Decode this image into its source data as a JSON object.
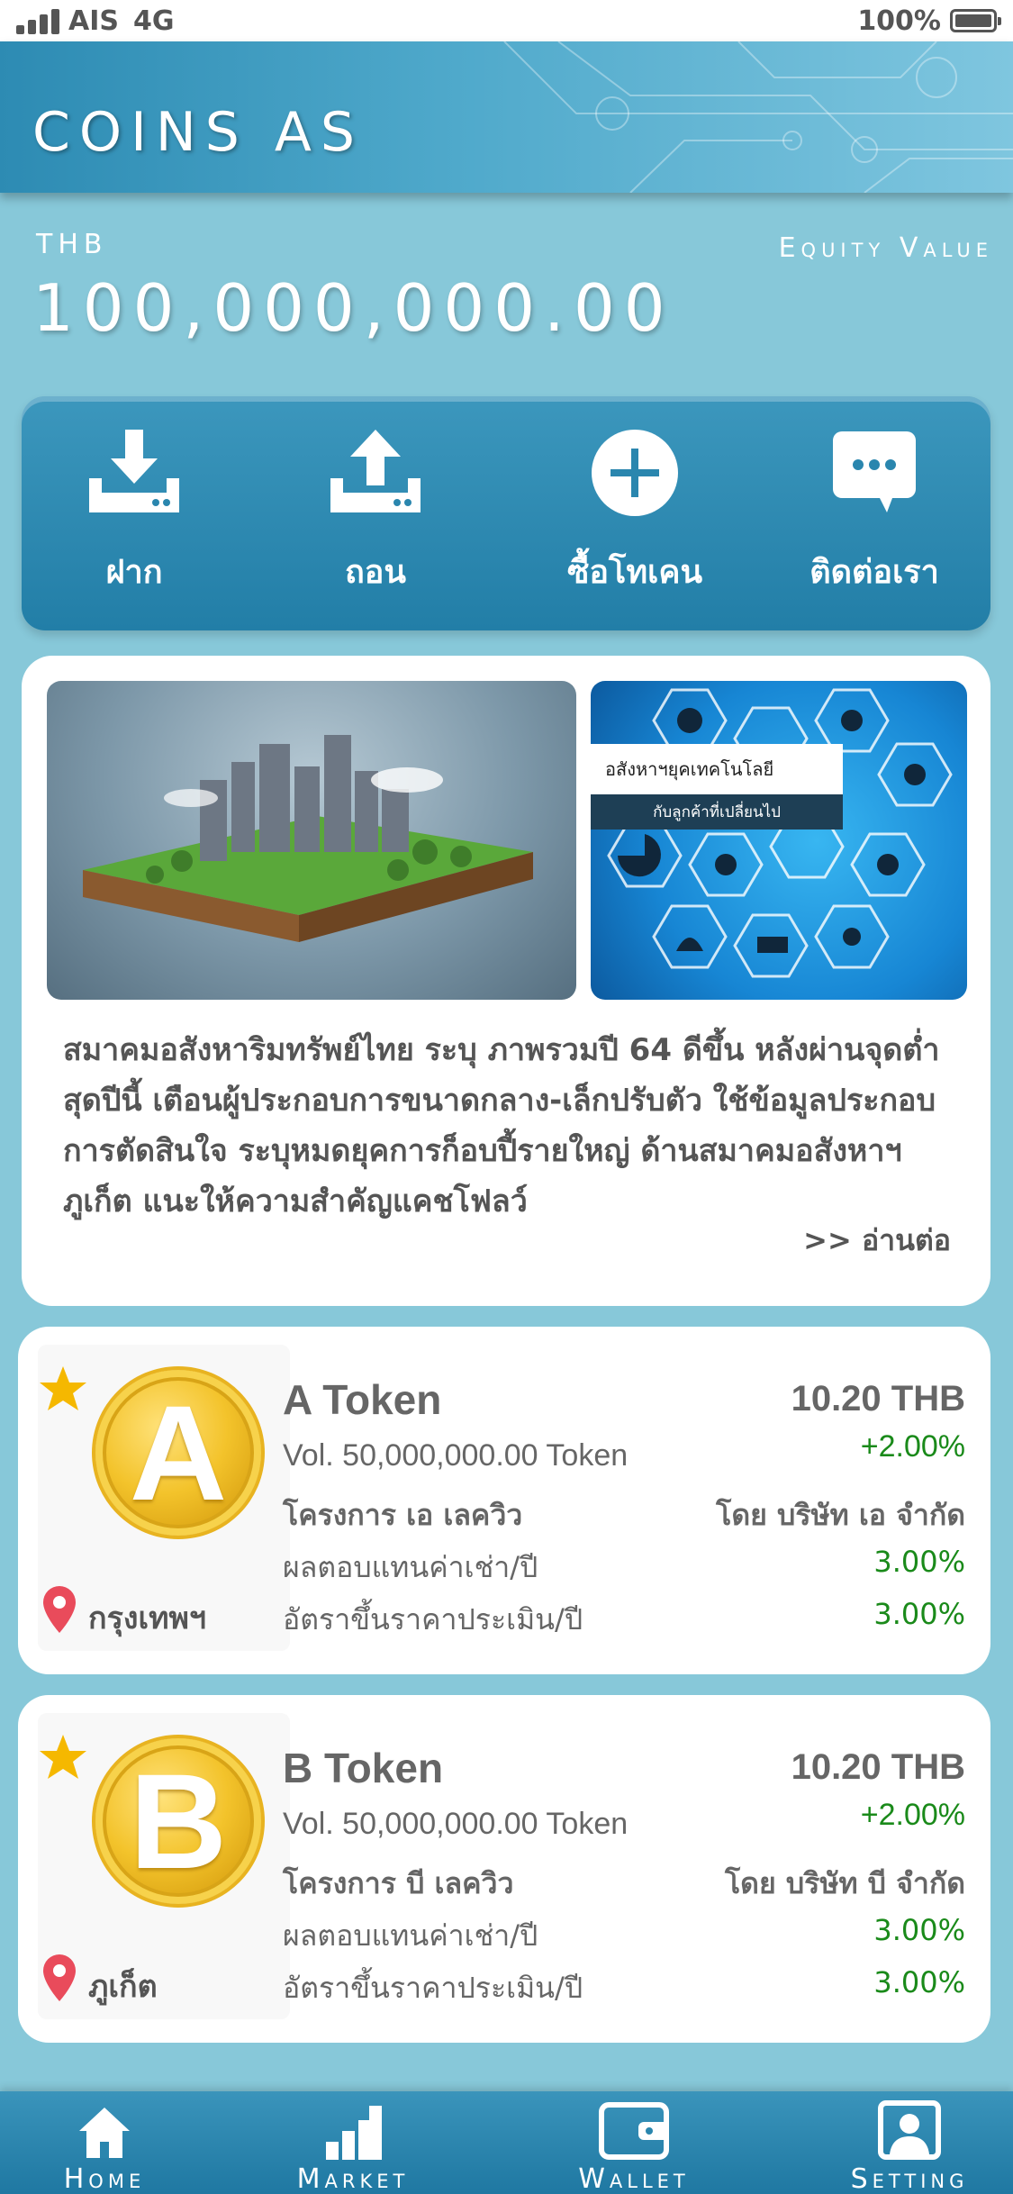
{
  "status_bar": {
    "carrier": "AIS",
    "network": "4G",
    "battery": "100%"
  },
  "header": {
    "title": "COINS AS"
  },
  "equity": {
    "currency": "THB",
    "label": "Equity Value",
    "value": "100,000,000.00"
  },
  "actions": [
    {
      "label": "ฝาก",
      "icon": "deposit-icon"
    },
    {
      "label": "ถอน",
      "icon": "withdraw-icon"
    },
    {
      "label": "ซื้อโทเคน",
      "icon": "plus-circle-icon"
    },
    {
      "label": "ติดต่อเรา",
      "icon": "chat-bubble-icon"
    }
  ],
  "news": {
    "image2_caption_main": "อสังหาฯยุคเทคโนโลยี",
    "image2_caption_sub": "กับลูกค้าที่เปลี่ยนไป",
    "text": "สมาคมอสังหาริมทรัพย์ไทย ระบุ ภาพรวมปี 64 ดีขึ้น หลังผ่านจุดต่ำสุดปีนี้ เตือนผู้ประกอบการขนาดกลาง-เล็กปรับตัว ใช้ข้อมูลประกอบการตัดสินใจ ระบุหมดยุคการก็อบปี้รายใหญ่ ด้านสมาคมอสังหาฯ ภูเก็ต แนะให้ความสำคัญแคชโฟลว์",
    "read_more": ">> อ่านต่อ"
  },
  "tokens": [
    {
      "coin_letter": "A",
      "name": "A Token",
      "price": "10.20 THB",
      "change": "+2.00%",
      "volume": "Vol. 50,000,000.00 Token",
      "project": "โครงการ เอ เลควิว",
      "company": "โดย บริษัท เอ จำกัด",
      "rent_label": "ผลตอบแทนค่าเช่า/ปี",
      "rent_value": "3.00%",
      "appraisal_label": "อัตราขึ้นราคาประเมิน/ปี",
      "appraisal_value": "3.00%",
      "location": "กรุงเทพฯ"
    },
    {
      "coin_letter": "B",
      "name": "B Token",
      "price": "10.20 THB",
      "change": "+2.00%",
      "volume": "Vol. 50,000,000.00 Token",
      "project": "โครงการ บี เลควิว",
      "company": "โดย บริษัท บี จำกัด",
      "rent_label": "ผลตอบแทนค่าเช่า/ปี",
      "rent_value": "3.00%",
      "appraisal_label": "อัตราขึ้นราคาประเมิน/ปี",
      "appraisal_value": "3.00%",
      "location": "ภูเก็ต"
    }
  ],
  "bottom_nav": [
    {
      "label": "Home",
      "icon": "home-icon"
    },
    {
      "label": "Market",
      "icon": "bar-chart-icon"
    },
    {
      "label": "Wallet",
      "icon": "wallet-icon"
    },
    {
      "label": "Setting",
      "icon": "user-profile-icon"
    }
  ],
  "colors": {
    "background": "#87c8d9",
    "accent_blue": "#227ea7",
    "positive_green": "#1a8a1a",
    "star_gold": "#f5b800",
    "pin_red": "#e94b5b"
  }
}
